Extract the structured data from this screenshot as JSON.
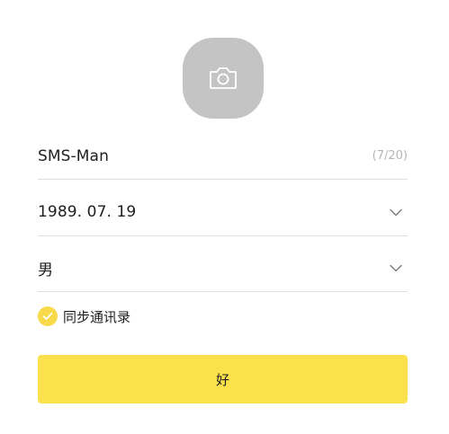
{
  "profile": {
    "avatar_icon": "camera-icon",
    "name": {
      "value": "SMS-Man",
      "counter": "(7/20)"
    },
    "birthday": {
      "value": "1989. 07. 19",
      "icon": "chevron-down-icon"
    },
    "gender": {
      "value": "男",
      "icon": "chevron-down-icon"
    },
    "sync_contacts": {
      "label": "同步通讯录",
      "checked": true,
      "icon": "checkmark-icon"
    },
    "confirm_label": "好"
  },
  "colors": {
    "accent": "#fbe24d",
    "checkbox": "#f8d94a",
    "avatar_bg": "#c4c4c4",
    "divider": "#dedede",
    "counter_text": "#b5b5b5"
  }
}
